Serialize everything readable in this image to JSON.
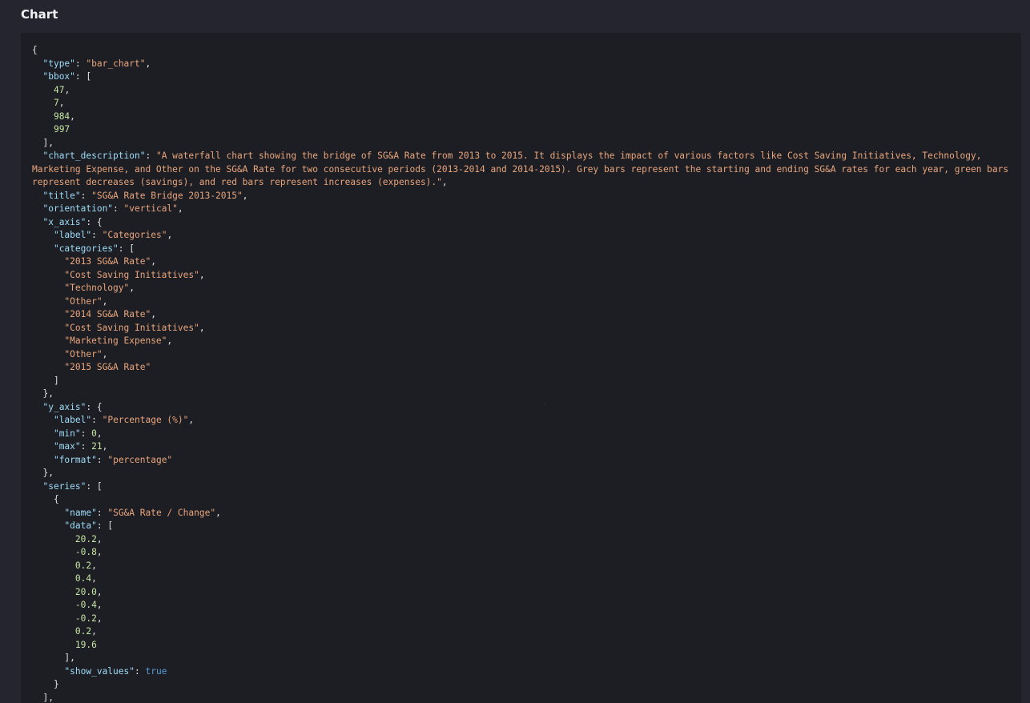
{
  "panel": {
    "title": "Chart"
  },
  "code_view": {
    "lines": [
      "{",
      "  \"type\": \"bar_chart\",",
      "  \"bbox\": [",
      "    47,",
      "    7,",
      "    984,",
      "    997",
      "  ],",
      "  \"chart_description\": \"A waterfall chart showing the bridge of SG&A Rate from 2013 to 2015. It displays the impact of various factors like Cost Saving Initiatives, Technology, Marketing Expense, and Other on the SG&A Rate for two consecutive periods (2013-2014 and 2014-2015). Grey bars represent the starting and ending SG&A rates for each year, green bars represent decreases (savings), and red bars represent increases (expenses).\",",
      "  \"title\": \"SG&A Rate Bridge 2013-2015\",",
      "  \"orientation\": \"vertical\",",
      "  \"x_axis\": {",
      "    \"label\": \"Categories\",",
      "    \"categories\": [",
      "      \"2013 SG&A Rate\",",
      "      \"Cost Saving Initiatives\",",
      "      \"Technology\",",
      "      \"Other\",",
      "      \"2014 SG&A Rate\",",
      "      \"Cost Saving Initiatives\",",
      "      \"Marketing Expense\",",
      "      \"Other\",",
      "      \"2015 SG&A Rate\"",
      "    ]",
      "  },",
      "  \"y_axis\": {",
      "    \"label\": \"Percentage (%)\",",
      "    \"min\": 0,",
      "    \"max\": 21,",
      "    \"format\": \"percentage\"",
      "  },",
      "  \"series\": [",
      "    {",
      "      \"name\": \"SG&A Rate / Change\",",
      "      \"data\": [",
      "        20.2,",
      "        -0.8,",
      "        0.2,",
      "        0.4,",
      "        20.0,",
      "        -0.4,",
      "        -0.2,",
      "        0.2,",
      "        19.6",
      "      ],",
      "      \"show_values\": true",
      "    }",
      "  ],"
    ]
  },
  "colors": {
    "background": "#24252e",
    "panel": "#1d1e24",
    "key": "#9ddcf8",
    "string": "#e9a57c",
    "number": "#c7e6a3",
    "boolean": "#569cd6"
  }
}
